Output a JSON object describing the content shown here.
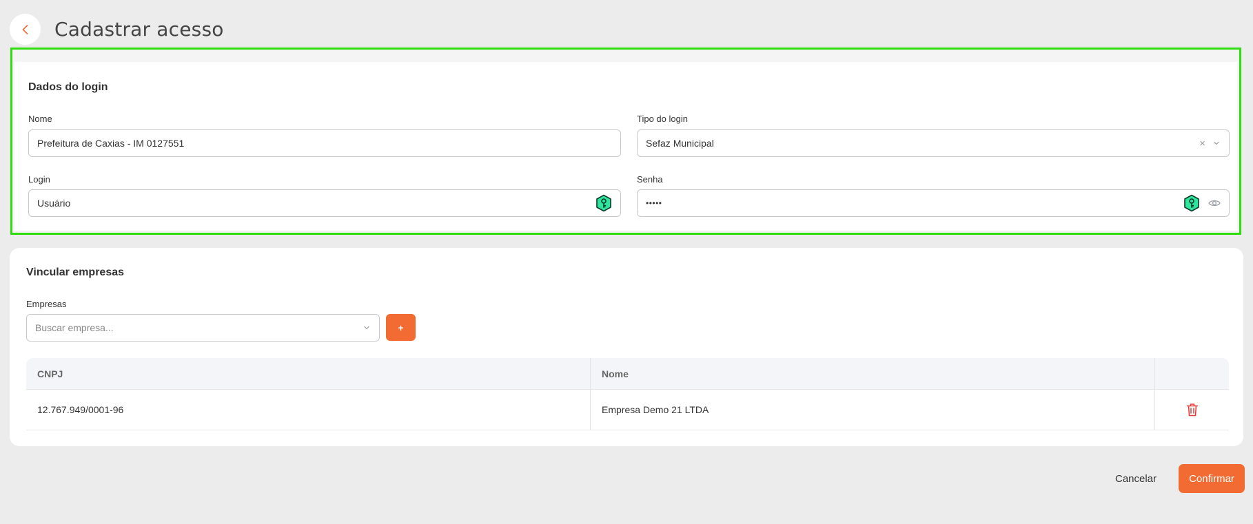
{
  "header": {
    "title": "Cadastrar acesso",
    "back_icon": "chevron-left-icon"
  },
  "login_section": {
    "title": "Dados do login",
    "nome": {
      "label": "Nome",
      "value": "Prefeitura de Caxias - IM 0127551"
    },
    "tipo_login": {
      "label": "Tipo do login",
      "value": "Sefaz Municipal",
      "clear_glyph": "×"
    },
    "login": {
      "label": "Login",
      "value": "Usuário",
      "icon": "key-hexagon-icon"
    },
    "senha": {
      "label": "Senha",
      "value": "•••••",
      "icon": "key-hexagon-icon",
      "toggle_icon": "eye-icon"
    }
  },
  "companies_section": {
    "title": "Vincular empresas",
    "empresas": {
      "label": "Empresas",
      "placeholder": "Buscar empresa..."
    },
    "add_label": "+",
    "table": {
      "headers": [
        "CNPJ",
        "Nome",
        ""
      ],
      "rows": [
        {
          "cnpj": "12.767.949/0001-96",
          "nome": "Empresa Demo 21 LTDA"
        }
      ]
    }
  },
  "footer": {
    "cancel_label": "Cancelar",
    "confirm_label": "Confirmar"
  },
  "colors": {
    "accent": "#f26b32",
    "highlight_border": "#2fdc0d",
    "key_icon_fill": "#2ee59d",
    "trash": "#e53935"
  }
}
